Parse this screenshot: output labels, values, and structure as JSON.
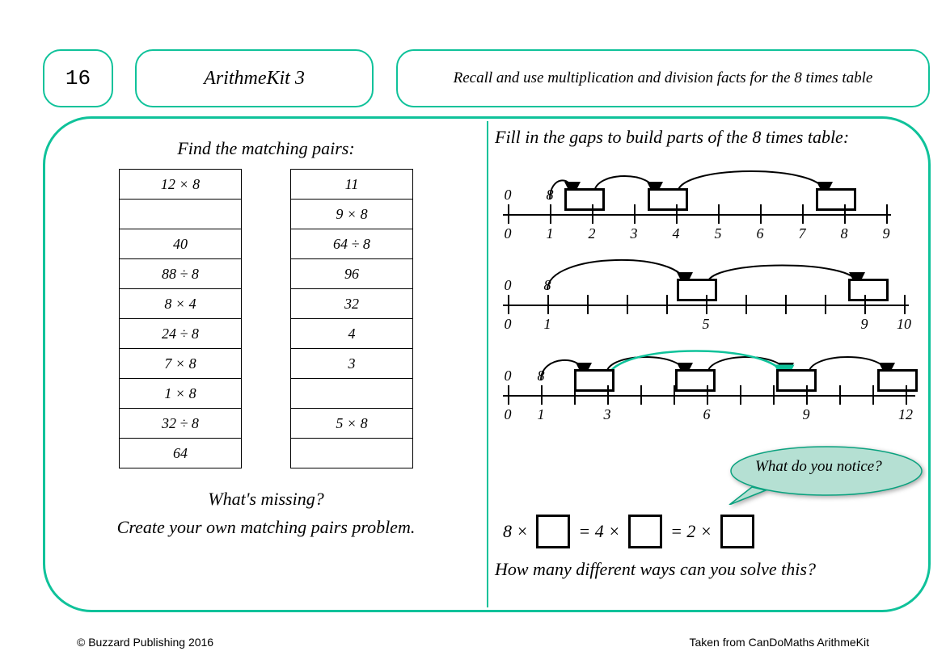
{
  "header": {
    "number": "16",
    "kit": "ArithmeKit 3",
    "objective": "Recall and use multiplication and division facts for the 8 times table"
  },
  "left": {
    "title": "Find the matching pairs:",
    "colA": [
      "12 × 8",
      "",
      "40",
      "88 ÷ 8",
      "8 × 4",
      "24 ÷ 8",
      "7 × 8",
      "1 × 8",
      "32 ÷ 8",
      "64"
    ],
    "colB": [
      "11",
      "9 × 8",
      "64 ÷ 8",
      "96",
      "32",
      "4",
      "3",
      "",
      "5 × 8",
      ""
    ],
    "q1": "What's missing?",
    "q2": "Create your own matching pairs problem."
  },
  "right": {
    "title": "Fill in the gaps to build parts of the 8 times table:",
    "nl1": {
      "top": [
        "0",
        "8"
      ],
      "bottom": [
        "0",
        "1",
        "2",
        "3",
        "4",
        "5",
        "6",
        "7",
        "8",
        "9"
      ]
    },
    "nl2": {
      "top": [
        "0",
        "8"
      ],
      "bottom": [
        "0",
        "1",
        "5",
        "9",
        "10"
      ]
    },
    "nl3": {
      "top": [
        "0",
        "8"
      ],
      "bottom": [
        "0",
        "1",
        "3",
        "6",
        "9",
        "12"
      ]
    },
    "bubble": "What do you notice?",
    "eq": {
      "a": "8 ×",
      "b": "= 4 ×",
      "c": "= 2 ×"
    },
    "q": "How many different ways can you solve this?"
  },
  "footer": {
    "left": "© Buzzard Publishing 2016",
    "right": "Taken from CanDoMaths ArithmeKit"
  }
}
